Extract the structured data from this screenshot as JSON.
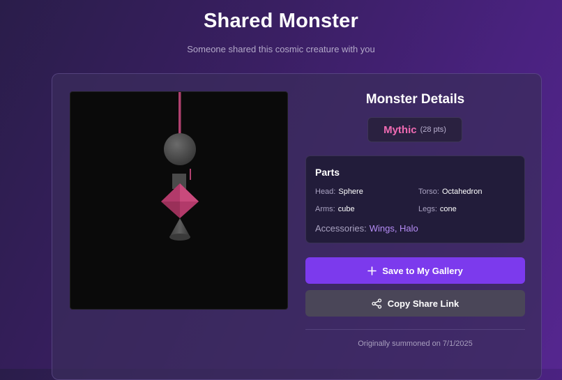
{
  "header": {
    "title": "Shared Monster",
    "subtitle": "Someone shared this cosmic creature with you"
  },
  "details": {
    "title": "Monster Details",
    "rarity": "Mythic",
    "points": "(28 pts)",
    "rarity_color": "#f06bb3"
  },
  "parts": {
    "title": "Parts",
    "head_label": "Head:",
    "head_value": "Sphere",
    "torso_label": "Torso:",
    "torso_value": "Octahedron",
    "arms_label": "Arms:",
    "arms_value": "cube",
    "legs_label": "Legs:",
    "legs_value": "cone",
    "accessories_label": "Accessories:",
    "accessories_value": "Wings, Halo"
  },
  "actions": {
    "save_label": "Save to My Gallery",
    "save_icon": "plus-icon",
    "copy_label": "Copy Share Link",
    "copy_icon": "share-icon",
    "accent": "#7c3aed"
  },
  "footer": {
    "summoned": "Originally summoned on 7/1/2025"
  }
}
